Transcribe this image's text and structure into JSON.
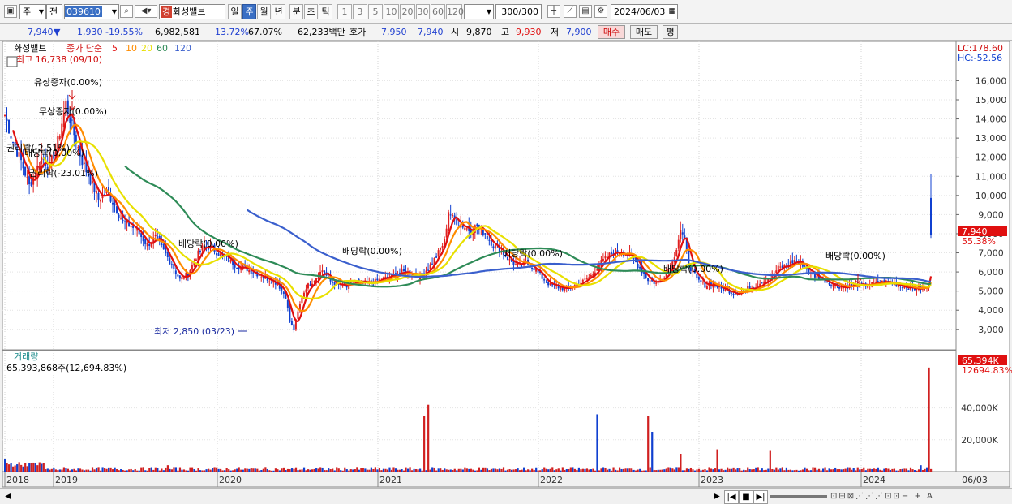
{
  "toolbar": {
    "market": "주",
    "period_type": "전",
    "code": "039610",
    "badge": "경",
    "name": "화성밸브",
    "tabs": [
      "일",
      "주",
      "월",
      "년",
      "분",
      "초",
      "틱"
    ],
    "active_tab": "주",
    "periods": [
      "1",
      "3",
      "5",
      "10",
      "20",
      "30",
      "60",
      "120"
    ],
    "count": "300/300",
    "date": "2024/06/03"
  },
  "quote": {
    "price": "7,940",
    "arrow": "▼",
    "change": "1,930",
    "change_pct": "-19.55%",
    "volume": "6,982,581",
    "turnover_pct": "13.72%",
    "vol_ratio": "67.07%",
    "amount": "62,233백만",
    "hoga_label": "호가",
    "ask": "7,950",
    "bid": "7,940",
    "open_label": "시",
    "open": "9,870",
    "high_label": "고",
    "high": "9,930",
    "low_label": "저",
    "low": "7,900",
    "buy_label": "매수",
    "sell_label": "매도",
    "avg_label": "평"
  },
  "price_panel": {
    "stock_label": "화성밸브",
    "legend_prefix": "종가 단순",
    "ma_labels": [
      "5",
      "10",
      "20",
      "60",
      "120"
    ],
    "ma_colors": [
      "#e01010",
      "#ff8c00",
      "#e8e000",
      "#2e8b57",
      "#3a5fcd"
    ],
    "lc": "LC:178.60",
    "hc": "HC:-52.56",
    "current": "7,940",
    "current_pct": "55.38%",
    "high_label": "최고 16,738 (09/10)",
    "low_label": "최저 2,850 (03/23)",
    "events": [
      "유상증자(0.00%)",
      "무상증자(0.00%)",
      "권리락(-2.51%)",
      "배당락(0.00%)",
      "권리락(-23.01%)",
      "배당락(0.00%)",
      "배당락(0.00%)",
      "배당락(0.00%)",
      "배당락(0.00%)",
      "배당락(0.00%)"
    ]
  },
  "volume_panel": {
    "label": "거래량",
    "value": "65,393,868주(12,694.83%)",
    "axis_badge": "65,394K",
    "axis_pct": "12694.83%"
  },
  "chart_data": {
    "type": "candlestick",
    "price_axis_ticks": [
      "16,000",
      "15,000",
      "14,000",
      "13,000",
      "12,000",
      "11,000",
      "10,000",
      "9,000",
      "8,000",
      "7,000",
      "6,000",
      "5,000",
      "4,000",
      "3,000"
    ],
    "volume_axis_ticks": [
      "40,000K",
      "20,000K"
    ],
    "x_labels": [
      "2018",
      "2019",
      "2020",
      "2021",
      "2022",
      "2023",
      "2024",
      "06/03"
    ],
    "ylim": [
      2100,
      17800
    ],
    "volume_max_k": 74000,
    "weekly_close_keypoints": [
      [
        0,
        14200
      ],
      [
        4,
        12800
      ],
      [
        8,
        11800
      ],
      [
        12,
        10500
      ],
      [
        15,
        11200
      ],
      [
        18,
        12000
      ],
      [
        22,
        11500
      ],
      [
        26,
        12800
      ],
      [
        30,
        14800
      ],
      [
        34,
        13200
      ],
      [
        38,
        11800
      ],
      [
        42,
        10800
      ],
      [
        46,
        9800
      ],
      [
        50,
        10200
      ],
      [
        54,
        9500
      ],
      [
        58,
        8600
      ],
      [
        62,
        8400
      ],
      [
        66,
        8000
      ],
      [
        70,
        7400
      ],
      [
        74,
        7800
      ],
      [
        78,
        7100
      ],
      [
        82,
        6400
      ],
      [
        86,
        5600
      ],
      [
        90,
        5900
      ],
      [
        94,
        6800
      ],
      [
        98,
        7400
      ],
      [
        102,
        7200
      ],
      [
        106,
        6900
      ],
      [
        110,
        6600
      ],
      [
        114,
        6300
      ],
      [
        118,
        6200
      ],
      [
        122,
        6000
      ],
      [
        126,
        5800
      ],
      [
        130,
        5600
      ],
      [
        134,
        5400
      ],
      [
        138,
        4700
      ],
      [
        140,
        3400
      ],
      [
        142,
        3000
      ],
      [
        144,
        3900
      ],
      [
        146,
        4700
      ],
      [
        148,
        5200
      ],
      [
        152,
        5600
      ],
      [
        156,
        6100
      ],
      [
        160,
        5500
      ],
      [
        164,
        5300
      ],
      [
        168,
        5200
      ],
      [
        172,
        5500
      ],
      [
        176,
        5400
      ],
      [
        180,
        5400
      ],
      [
        184,
        5600
      ],
      [
        188,
        5700
      ],
      [
        192,
        5900
      ],
      [
        196,
        6000
      ],
      [
        200,
        5900
      ],
      [
        204,
        5800
      ],
      [
        208,
        6200
      ],
      [
        212,
        6800
      ],
      [
        216,
        7600
      ],
      [
        218,
        9200
      ],
      [
        220,
        8800
      ],
      [
        224,
        8500
      ],
      [
        228,
        8200
      ],
      [
        232,
        8400
      ],
      [
        236,
        8000
      ],
      [
        240,
        7400
      ],
      [
        244,
        7100
      ],
      [
        248,
        6600
      ],
      [
        252,
        6300
      ],
      [
        256,
        6500
      ],
      [
        260,
        6200
      ],
      [
        264,
        5700
      ],
      [
        268,
        5300
      ],
      [
        272,
        5200
      ],
      [
        276,
        5100
      ],
      [
        280,
        5300
      ],
      [
        284,
        5500
      ],
      [
        288,
        5800
      ],
      [
        292,
        6400
      ],
      [
        296,
        6800
      ],
      [
        300,
        7100
      ],
      [
        304,
        7000
      ],
      [
        308,
        6800
      ],
      [
        312,
        6200
      ],
      [
        316,
        5600
      ],
      [
        320,
        5400
      ],
      [
        324,
        5800
      ],
      [
        328,
        6500
      ],
      [
        330,
        7300
      ],
      [
        332,
        8200
      ],
      [
        334,
        7600
      ],
      [
        336,
        6400
      ],
      [
        340,
        5600
      ],
      [
        344,
        5300
      ],
      [
        348,
        5400
      ],
      [
        352,
        5100
      ],
      [
        356,
        5000
      ],
      [
        360,
        4900
      ],
      [
        364,
        5100
      ],
      [
        368,
        5200
      ],
      [
        372,
        5500
      ],
      [
        376,
        5700
      ],
      [
        380,
        6200
      ],
      [
        384,
        6300
      ],
      [
        388,
        6600
      ],
      [
        392,
        6400
      ],
      [
        396,
        5900
      ],
      [
        400,
        5700
      ],
      [
        404,
        5500
      ],
      [
        408,
        5300
      ],
      [
        412,
        5200
      ],
      [
        416,
        5300
      ],
      [
        420,
        5300
      ],
      [
        424,
        5300
      ],
      [
        428,
        5400
      ],
      [
        432,
        5500
      ],
      [
        436,
        5400
      ],
      [
        440,
        5300
      ],
      [
        444,
        5200
      ],
      [
        448,
        5100
      ],
      [
        452,
        5200
      ],
      [
        454,
        5200
      ],
      [
        455,
        7940
      ]
    ],
    "volume_spikes_k": [
      [
        0,
        8000
      ],
      [
        80,
        4000
      ],
      [
        206,
        35000
      ],
      [
        208,
        42000
      ],
      [
        291,
        36000
      ],
      [
        316,
        35000
      ],
      [
        318,
        25000
      ],
      [
        332,
        11000
      ],
      [
        350,
        14000
      ],
      [
        376,
        13000
      ],
      [
        450,
        4000
      ],
      [
        454,
        65394
      ]
    ]
  }
}
